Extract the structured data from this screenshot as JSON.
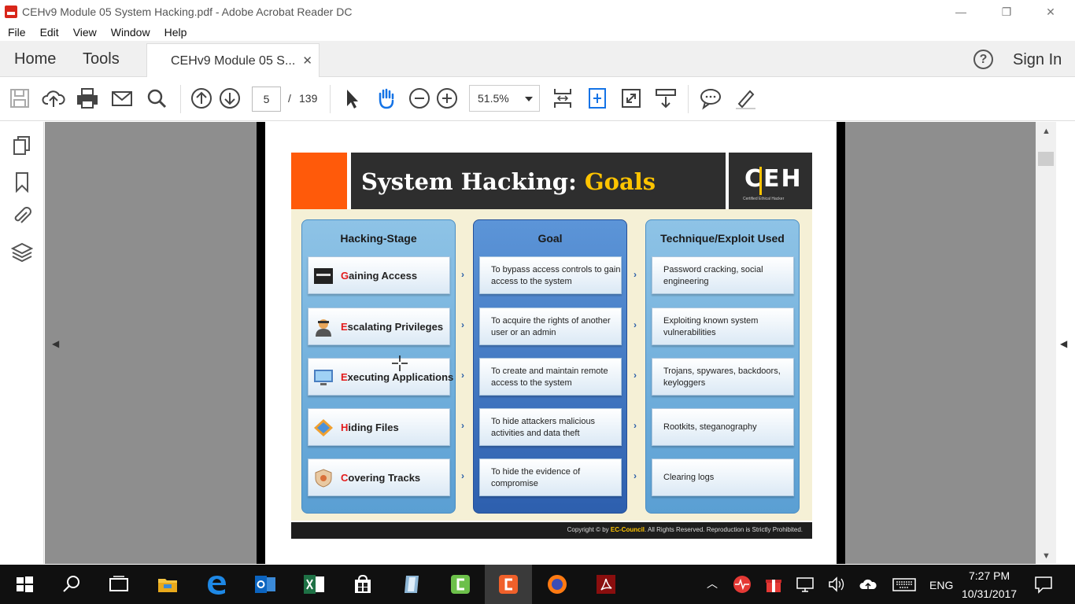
{
  "window": {
    "title": "CEHv9 Module 05 System Hacking.pdf - Adobe Acrobat Reader DC",
    "minimize": "—",
    "restore": "❐",
    "close": "✕"
  },
  "menu": [
    "File",
    "Edit",
    "View",
    "Window",
    "Help"
  ],
  "tabs": {
    "home": "Home",
    "tools": "Tools",
    "doc_tab": "CEHv9 Module 05 S...",
    "doc_tab_close": "✕",
    "help": "?",
    "sign_in": "Sign In"
  },
  "toolbar": {
    "current_page": "5",
    "page_sep": "/",
    "total_pages": "139",
    "zoom": "51.5%"
  },
  "slide": {
    "title_part1": "System Hacking: ",
    "title_part2": "Goals",
    "logo": "CEH",
    "logo_sub": "Certified  Ethical  Hacker",
    "headers": {
      "stage": "Hacking-Stage",
      "goal": "Goal",
      "technique": "Technique/Exploit Used"
    },
    "rows": [
      {
        "stage_first": "G",
        "stage_rest": "aining Access",
        "icon": "terminal-icon",
        "goal": "To bypass access controls to gain access to the system",
        "technique": "Password cracking, social engineering"
      },
      {
        "stage_first": "E",
        "stage_rest": "scalating Privileges",
        "icon": "user-icon",
        "goal": "To acquire the rights of another user or an admin",
        "technique": "Exploiting known system vulnerabilities"
      },
      {
        "stage_first": "E",
        "stage_rest": "xecuting Applications",
        "icon": "monitor-icon",
        "goal": "To create and maintain remote access to the system",
        "technique": "Trojans, spywares, backdoors, keyloggers"
      },
      {
        "stage_first": "H",
        "stage_rest": "iding Files",
        "icon": "folder-icon",
        "goal": "To hide attackers malicious activities and data theft",
        "technique": "Rootkits, steganography"
      },
      {
        "stage_first": "C",
        "stage_rest": "overing Tracks",
        "icon": "shield-icon",
        "goal": "To hide the evidence of compromise",
        "technique": "Clearing logs"
      }
    ],
    "footer_pre": "Copyright © by ",
    "footer_brand": "EC-Council",
    "footer_post": ". All Rights Reserved. Reproduction is Strictly Prohibited."
  },
  "taskbar": {
    "time": "7:27 PM",
    "date": "10/31/2017",
    "lang": "ENG"
  }
}
